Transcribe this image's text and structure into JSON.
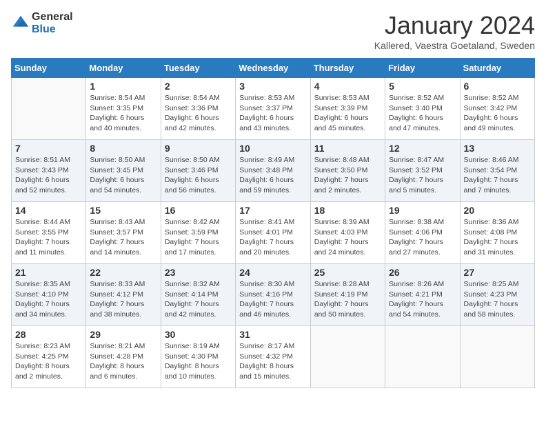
{
  "logo": {
    "general": "General",
    "blue": "Blue"
  },
  "title": "January 2024",
  "subtitle": "Kallered, Vaestra Goetaland, Sweden",
  "days_header": [
    "Sunday",
    "Monday",
    "Tuesday",
    "Wednesday",
    "Thursday",
    "Friday",
    "Saturday"
  ],
  "weeks": [
    [
      {
        "day": "",
        "info": ""
      },
      {
        "day": "1",
        "info": "Sunrise: 8:54 AM\nSunset: 3:35 PM\nDaylight: 6 hours\nand 40 minutes."
      },
      {
        "day": "2",
        "info": "Sunrise: 8:54 AM\nSunset: 3:36 PM\nDaylight: 6 hours\nand 42 minutes."
      },
      {
        "day": "3",
        "info": "Sunrise: 8:53 AM\nSunset: 3:37 PM\nDaylight: 6 hours\nand 43 minutes."
      },
      {
        "day": "4",
        "info": "Sunrise: 8:53 AM\nSunset: 3:39 PM\nDaylight: 6 hours\nand 45 minutes."
      },
      {
        "day": "5",
        "info": "Sunrise: 8:52 AM\nSunset: 3:40 PM\nDaylight: 6 hours\nand 47 minutes."
      },
      {
        "day": "6",
        "info": "Sunrise: 8:52 AM\nSunset: 3:42 PM\nDaylight: 6 hours\nand 49 minutes."
      }
    ],
    [
      {
        "day": "7",
        "info": "Sunrise: 8:51 AM\nSunset: 3:43 PM\nDaylight: 6 hours\nand 52 minutes."
      },
      {
        "day": "8",
        "info": "Sunrise: 8:50 AM\nSunset: 3:45 PM\nDaylight: 6 hours\nand 54 minutes."
      },
      {
        "day": "9",
        "info": "Sunrise: 8:50 AM\nSunset: 3:46 PM\nDaylight: 6 hours\nand 56 minutes."
      },
      {
        "day": "10",
        "info": "Sunrise: 8:49 AM\nSunset: 3:48 PM\nDaylight: 6 hours\nand 59 minutes."
      },
      {
        "day": "11",
        "info": "Sunrise: 8:48 AM\nSunset: 3:50 PM\nDaylight: 7 hours\nand 2 minutes."
      },
      {
        "day": "12",
        "info": "Sunrise: 8:47 AM\nSunset: 3:52 PM\nDaylight: 7 hours\nand 5 minutes."
      },
      {
        "day": "13",
        "info": "Sunrise: 8:46 AM\nSunset: 3:54 PM\nDaylight: 7 hours\nand 7 minutes."
      }
    ],
    [
      {
        "day": "14",
        "info": "Sunrise: 8:44 AM\nSunset: 3:55 PM\nDaylight: 7 hours\nand 11 minutes."
      },
      {
        "day": "15",
        "info": "Sunrise: 8:43 AM\nSunset: 3:57 PM\nDaylight: 7 hours\nand 14 minutes."
      },
      {
        "day": "16",
        "info": "Sunrise: 8:42 AM\nSunset: 3:59 PM\nDaylight: 7 hours\nand 17 minutes."
      },
      {
        "day": "17",
        "info": "Sunrise: 8:41 AM\nSunset: 4:01 PM\nDaylight: 7 hours\nand 20 minutes."
      },
      {
        "day": "18",
        "info": "Sunrise: 8:39 AM\nSunset: 4:03 PM\nDaylight: 7 hours\nand 24 minutes."
      },
      {
        "day": "19",
        "info": "Sunrise: 8:38 AM\nSunset: 4:06 PM\nDaylight: 7 hours\nand 27 minutes."
      },
      {
        "day": "20",
        "info": "Sunrise: 8:36 AM\nSunset: 4:08 PM\nDaylight: 7 hours\nand 31 minutes."
      }
    ],
    [
      {
        "day": "21",
        "info": "Sunrise: 8:35 AM\nSunset: 4:10 PM\nDaylight: 7 hours\nand 34 minutes."
      },
      {
        "day": "22",
        "info": "Sunrise: 8:33 AM\nSunset: 4:12 PM\nDaylight: 7 hours\nand 38 minutes."
      },
      {
        "day": "23",
        "info": "Sunrise: 8:32 AM\nSunset: 4:14 PM\nDaylight: 7 hours\nand 42 minutes."
      },
      {
        "day": "24",
        "info": "Sunrise: 8:30 AM\nSunset: 4:16 PM\nDaylight: 7 hours\nand 46 minutes."
      },
      {
        "day": "25",
        "info": "Sunrise: 8:28 AM\nSunset: 4:19 PM\nDaylight: 7 hours\nand 50 minutes."
      },
      {
        "day": "26",
        "info": "Sunrise: 8:26 AM\nSunset: 4:21 PM\nDaylight: 7 hours\nand 54 minutes."
      },
      {
        "day": "27",
        "info": "Sunrise: 8:25 AM\nSunset: 4:23 PM\nDaylight: 7 hours\nand 58 minutes."
      }
    ],
    [
      {
        "day": "28",
        "info": "Sunrise: 8:23 AM\nSunset: 4:25 PM\nDaylight: 8 hours\nand 2 minutes."
      },
      {
        "day": "29",
        "info": "Sunrise: 8:21 AM\nSunset: 4:28 PM\nDaylight: 8 hours\nand 6 minutes."
      },
      {
        "day": "30",
        "info": "Sunrise: 8:19 AM\nSunset: 4:30 PM\nDaylight: 8 hours\nand 10 minutes."
      },
      {
        "day": "31",
        "info": "Sunrise: 8:17 AM\nSunset: 4:32 PM\nDaylight: 8 hours\nand 15 minutes."
      },
      {
        "day": "",
        "info": ""
      },
      {
        "day": "",
        "info": ""
      },
      {
        "day": "",
        "info": ""
      }
    ]
  ]
}
